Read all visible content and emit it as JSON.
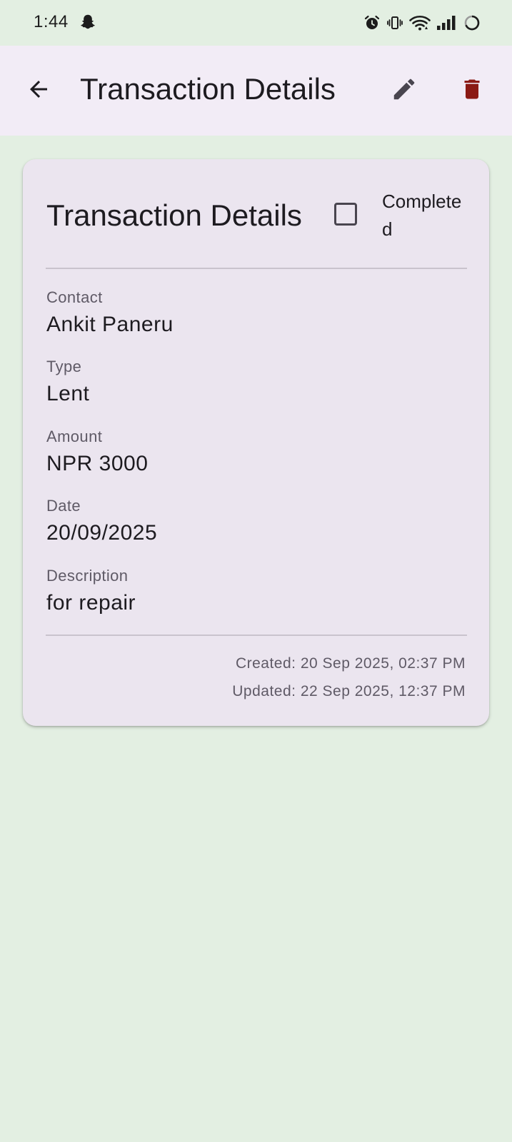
{
  "status_bar": {
    "time": "1:44",
    "notification_icon": "snapchat-ghost-icon",
    "icons": [
      "alarm-icon",
      "vibrate-icon",
      "wifi-icon",
      "signal-icon",
      "battery-icon"
    ]
  },
  "app_bar": {
    "title": "Transaction Details",
    "back_icon": "arrow-back-icon",
    "edit_icon": "edit-pencil-icon",
    "delete_icon": "trash-icon",
    "delete_color": "#8b1a14"
  },
  "card": {
    "title": "Transaction Details",
    "completed_label": "Completed",
    "completed_checked": false,
    "fields": [
      {
        "label": "Contact",
        "value": "Ankit Paneru"
      },
      {
        "label": "Type",
        "value": "Lent"
      },
      {
        "label": "Amount",
        "value": "NPR 3000"
      },
      {
        "label": "Date",
        "value": "20/09/2025"
      },
      {
        "label": "Description",
        "value": "for repair"
      }
    ],
    "created": "Created: 20 Sep 2025, 02:37 PM",
    "updated": "Updated: 22 Sep 2025, 12:37 PM"
  },
  "colors": {
    "background": "#e3efe2",
    "app_bar": "#f2ecf6",
    "card": "#ebe5ef",
    "delete_red": "#8b1a14"
  }
}
